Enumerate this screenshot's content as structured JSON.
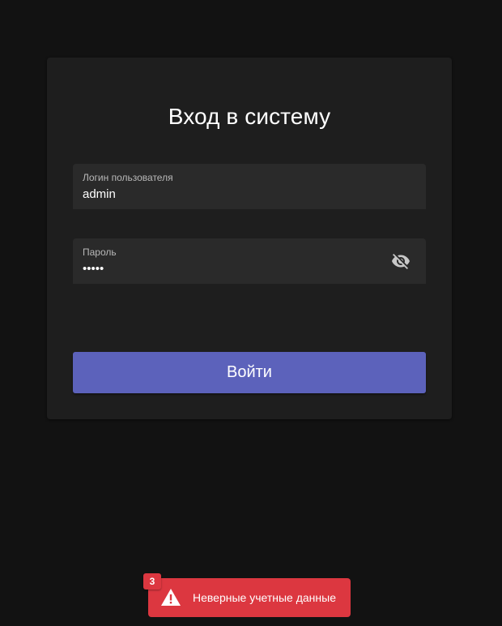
{
  "login_form": {
    "title": "Вход в систему",
    "username_field": {
      "label": "Логин пользователя",
      "value": "admin"
    },
    "password_field": {
      "label": "Пароль",
      "value": "•••••",
      "visibility_icon": "eye-off-icon"
    },
    "submit_label": "Войти"
  },
  "notification": {
    "count": "3",
    "icon": "warning-icon",
    "message": "Неверные учетные данные",
    "color": "#dc3740"
  },
  "colors": {
    "background": "#121212",
    "card": "#1e1e1e",
    "field": "#2a2a2a",
    "primary": "#5c62bb"
  }
}
